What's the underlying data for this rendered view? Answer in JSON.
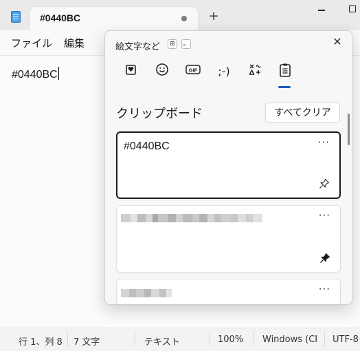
{
  "window": {
    "tab_title": "#0440BC",
    "new_tab_label": "+"
  },
  "menu": {
    "items": [
      {
        "label": "ファイル"
      },
      {
        "label": "編集"
      }
    ]
  },
  "editor": {
    "content": "#0440BC"
  },
  "emoji_panel": {
    "title": "絵文字など",
    "shortcut_keys": [
      "⊞",
      "。"
    ],
    "close_label": "✕",
    "categories": [
      {
        "name": "favorites",
        "icon": "heart-clip-icon"
      },
      {
        "name": "emoji",
        "icon": "smiley-icon"
      },
      {
        "name": "gif",
        "icon": "gif-icon",
        "label": "GIF"
      },
      {
        "name": "kaomoji",
        "icon": "kaomoji-icon",
        "label": ";-)"
      },
      {
        "name": "symbols",
        "icon": "symbols-icon"
      },
      {
        "name": "clipboard",
        "icon": "clipboard-icon",
        "selected": true
      }
    ],
    "section_title": "クリップボード",
    "clear_all_label": "すべてクリア",
    "clipboard_items": [
      {
        "text": "#0440BC",
        "more": "···",
        "pinned": false,
        "selected": true
      },
      {
        "text": "",
        "more": "···",
        "pinned": true,
        "redacted": true
      },
      {
        "text": "",
        "more": "···",
        "redacted": true
      }
    ]
  },
  "status_bar": {
    "position": "行 1、列 8",
    "char_count": "7 文字",
    "format": "テキスト",
    "zoom": "100%",
    "line_ending": "Windows (CI",
    "encoding": "UTF-8"
  },
  "colors": {
    "accent": "#1f5bb5",
    "panel_bg": "#f7f7f7",
    "window_bg": "#f3f3f3"
  }
}
